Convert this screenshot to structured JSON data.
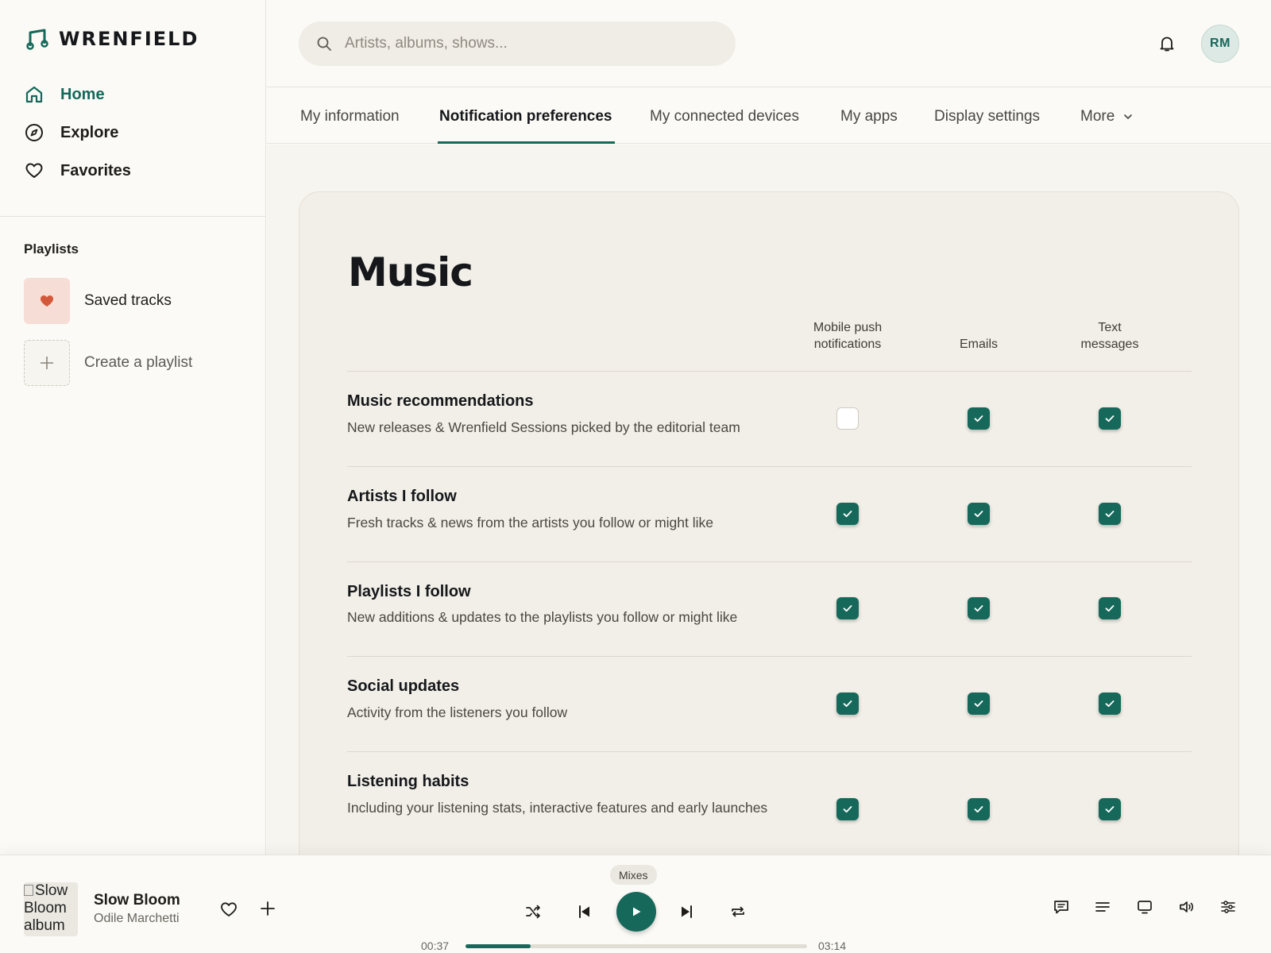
{
  "app": {
    "name": "WRENFIELD"
  },
  "sidebar": {
    "nav": [
      {
        "label": "Home",
        "icon": "home-icon",
        "active": true
      },
      {
        "label": "Explore",
        "icon": "compass-icon",
        "active": false
      },
      {
        "label": "Favorites",
        "icon": "heart-outline-icon",
        "active": false
      }
    ],
    "playlists_heading": "Playlists",
    "playlists": [
      {
        "label": "Saved tracks",
        "icon": "heart-icon"
      },
      {
        "label": "Create a playlist",
        "icon": "plus-icon"
      }
    ]
  },
  "header": {
    "search_placeholder": "Artists, albums, shows...",
    "avatar_initials": "RM"
  },
  "tabs": [
    {
      "label": "My information",
      "active": false
    },
    {
      "label": "Notification preferences",
      "active": true
    },
    {
      "label": "My connected devices",
      "active": false
    },
    {
      "label": "My apps",
      "active": false
    },
    {
      "label": "Display settings",
      "active": false
    },
    {
      "label": "More",
      "active": false
    }
  ],
  "section": {
    "title": "Music",
    "columns": [
      {
        "line1": "Mobile push",
        "line2": "notifications"
      },
      {
        "line1": "Emails",
        "line2": ""
      },
      {
        "line1": "Text",
        "line2": "messages"
      }
    ],
    "rows": [
      {
        "title": "Music recommendations",
        "desc": "New releases & Wrenfield Sessions picked by the editorial team",
        "push": false,
        "email": true,
        "text": true
      },
      {
        "title": "Artists I follow",
        "desc": "Fresh tracks & news from the artists you follow or might like",
        "push": true,
        "email": true,
        "text": true
      },
      {
        "title": "Playlists I follow",
        "desc": "New additions & updates to the playlists you follow or might like",
        "push": true,
        "email": true,
        "text": true
      },
      {
        "title": "Social updates",
        "desc": "Activity from the listeners you follow",
        "push": true,
        "email": true,
        "text": true
      },
      {
        "title": "Listening habits",
        "desc": "Including your listening stats, interactive features and early launches",
        "push": true,
        "email": true,
        "text": true
      }
    ]
  },
  "player": {
    "album_alt": "Slow Bloom album",
    "track_title": "Slow Bloom",
    "artist": "Odile Marchetti",
    "context": "Mixes",
    "time_elapsed": "00:37",
    "time_total": "03:14",
    "progress": 0.19
  },
  "colors": {
    "accent": "#15685a",
    "background": "#fbfaf6",
    "card": "#f2efe8",
    "saved_tracks_tile": "#f6ddd5",
    "heart": "#d4593a"
  }
}
